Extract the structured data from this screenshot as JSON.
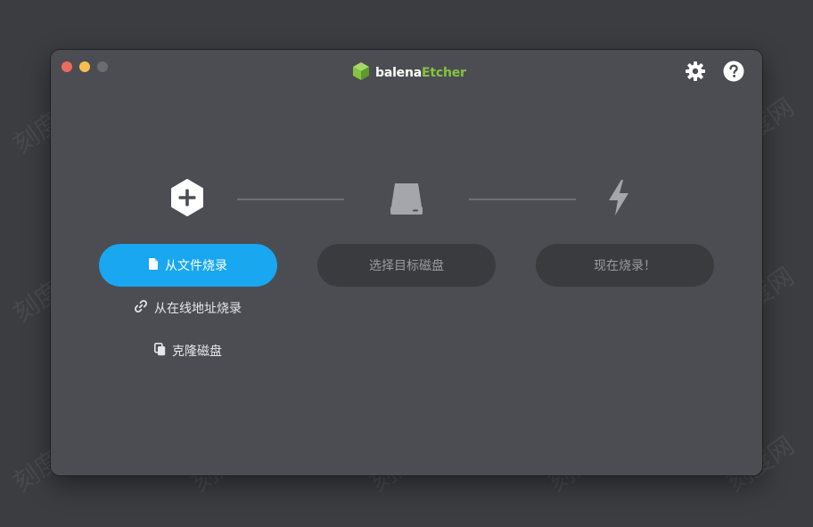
{
  "window": {
    "brand": {
      "prefix": "balena",
      "suffix": "Etcher"
    }
  },
  "toolbar": {
    "settings_icon": "gear-icon",
    "help_icon": "question-mark-icon"
  },
  "steps": {
    "source_icon": "plus-hexagon-icon",
    "target_icon": "drive-icon",
    "flash_icon": "lightning-bolt-icon"
  },
  "actions": {
    "flash_from_file": "从文件烧录",
    "select_target": "选择目标磁盘",
    "flash_now": "现在烧录！",
    "flash_from_url": "从在线地址烧录",
    "clone_drive": "克隆磁盘"
  },
  "watermark": {
    "text": "刻度网"
  },
  "colors": {
    "background": "#3c3d41",
    "window": "#4c4d52",
    "primary": "#18a7f0",
    "brand_accent": "#85c441",
    "disabled_button": "#3a3b3f"
  }
}
